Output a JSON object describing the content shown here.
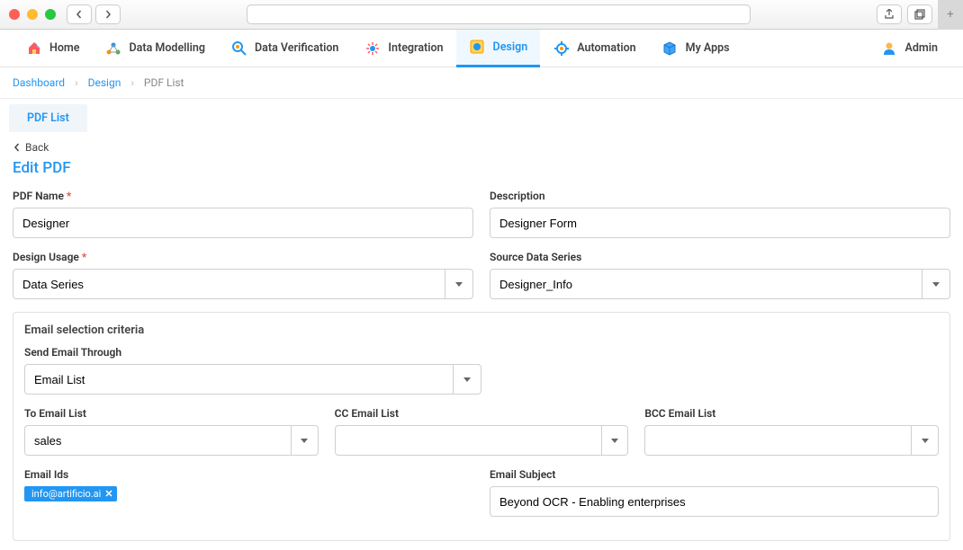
{
  "nav": {
    "home": "Home",
    "data_modelling": "Data Modelling",
    "data_verification": "Data Verification",
    "integration": "Integration",
    "design": "Design",
    "automation": "Automation",
    "my_apps": "My Apps",
    "admin": "Admin"
  },
  "breadcrumb": {
    "b0": "Dashboard",
    "b1": "Design",
    "b2": "PDF List"
  },
  "subtab": {
    "pdf_list": "PDF List"
  },
  "page": {
    "back": "Back",
    "title": "Edit PDF"
  },
  "form": {
    "pdf_name": {
      "label": "PDF Name",
      "value": "Designer"
    },
    "description": {
      "label": "Description",
      "value": "Designer Form"
    },
    "design_usage": {
      "label": "Design Usage",
      "value": "Data Series"
    },
    "source_data_series": {
      "label": "Source Data Series",
      "value": "Designer_Info"
    }
  },
  "email_section": {
    "title": "Email selection criteria",
    "send_through": {
      "label": "Send Email Through",
      "value": "Email List"
    },
    "to": {
      "label": "To Email List",
      "value": "sales"
    },
    "cc": {
      "label": "CC Email List",
      "value": ""
    },
    "bcc": {
      "label": "BCC Email List",
      "value": ""
    },
    "email_ids": {
      "label": "Email Ids",
      "tag": "info@artificio.ai"
    },
    "subject": {
      "label": "Email Subject",
      "value": "Beyond OCR - Enabling enterprises"
    }
  }
}
